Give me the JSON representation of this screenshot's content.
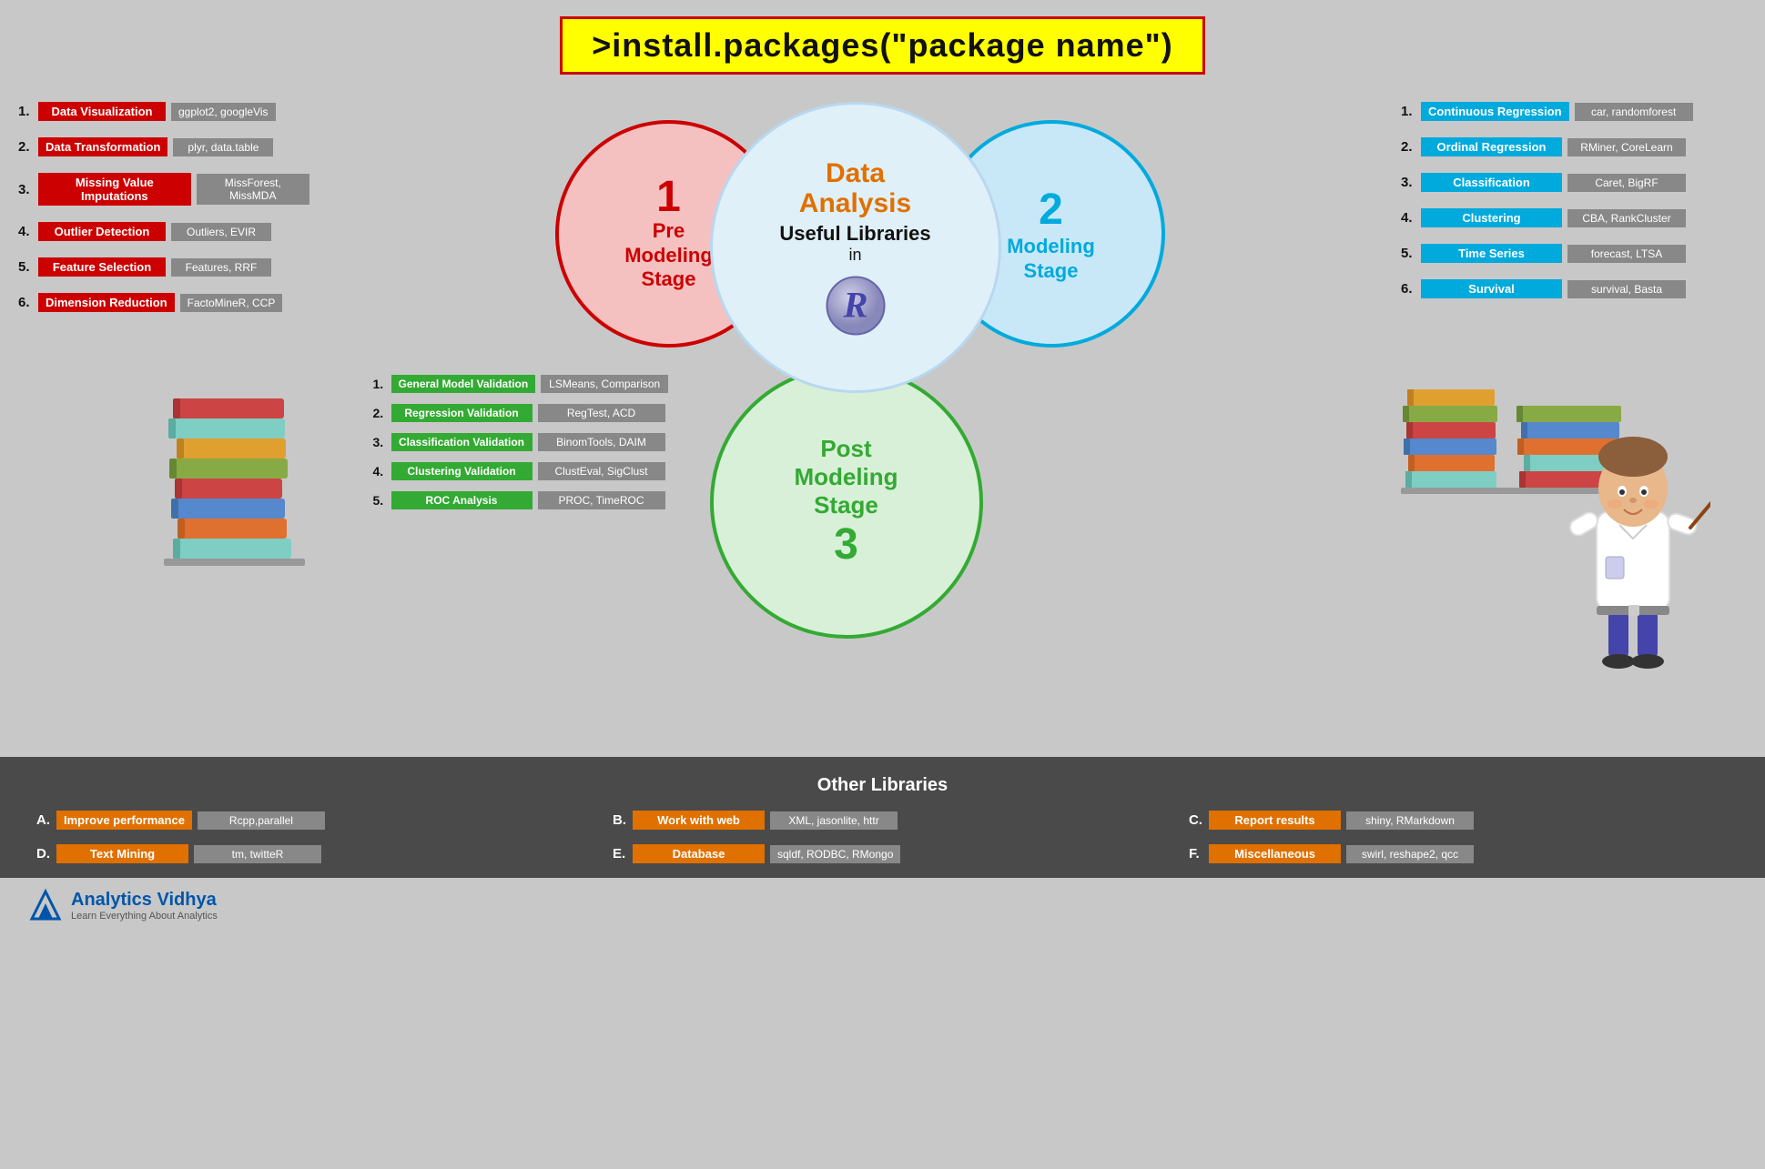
{
  "header": {
    "install_command": ">install.packages(\"package name\")"
  },
  "main_title": {
    "line1": "Data",
    "line2": "Analysis",
    "line3": "Useful Libraries",
    "line4": "in"
  },
  "pre_modeling": {
    "number": "1",
    "title": "Pre\nModeling\nStage",
    "items": [
      {
        "num": "1.",
        "label": "Data Visualization",
        "value": "ggplot2, googleVis"
      },
      {
        "num": "2.",
        "label": "Data Transformation",
        "value": "plyr, data.table"
      },
      {
        "num": "3.",
        "label": "Missing Value Imputations",
        "value": "MissForest, MissMDA"
      },
      {
        "num": "4.",
        "label": "Outlier Detection",
        "value": "Outliers, EVIR"
      },
      {
        "num": "5.",
        "label": "Feature Selection",
        "value": "Features, RRF"
      },
      {
        "num": "6.",
        "label": "Dimension Reduction",
        "value": "FactoMineR, CCP"
      }
    ]
  },
  "modeling": {
    "number": "2",
    "title": "Modeling\nStage",
    "items": [
      {
        "num": "1.",
        "label": "Continuous Regression",
        "value": "car, randomforest"
      },
      {
        "num": "2.",
        "label": "Ordinal Regression",
        "value": "RMiner, CoreLearn"
      },
      {
        "num": "3.",
        "label": "Classification",
        "value": "Caret, BigRF"
      },
      {
        "num": "4.",
        "label": "Clustering",
        "value": "CBA, RankCluster"
      },
      {
        "num": "5.",
        "label": "Time Series",
        "value": "forecast, LTSA"
      },
      {
        "num": "6.",
        "label": "Survival",
        "value": "survival, Basta"
      }
    ]
  },
  "post_modeling": {
    "number": "3",
    "title": "Post\nModeling\nStage",
    "items": [
      {
        "num": "1.",
        "label": "General Model Validation",
        "value": "LSMeans, Comparison"
      },
      {
        "num": "2.",
        "label": "Regression Validation",
        "value": "RegTest, ACD"
      },
      {
        "num": "3.",
        "label": "Classification Validation",
        "value": "BinomTools, DAIM"
      },
      {
        "num": "4.",
        "label": "Clustering Validation",
        "value": "ClustEval, SigClust"
      },
      {
        "num": "5.",
        "label": "ROC Analysis",
        "value": "PROC, TimeROC"
      }
    ]
  },
  "other_libraries": {
    "title": "Other Libraries",
    "items": [
      {
        "letter": "A.",
        "label": "Improve performance",
        "value": "Rcpp,parallel"
      },
      {
        "letter": "B.",
        "label": "Work with web",
        "value": "XML, jasonlite, httr"
      },
      {
        "letter": "C.",
        "label": "Report results",
        "value": "shiny, RMarkdown"
      },
      {
        "letter": "D.",
        "label": "Text Mining",
        "value": "tm, twitteR"
      },
      {
        "letter": "E.",
        "label": "Database",
        "value": "sqldf, RODBC, RMongo"
      },
      {
        "letter": "F.",
        "label": "Miscellaneous",
        "value": "swirl, reshape2, qcc"
      }
    ]
  },
  "footer": {
    "brand": "Analytics Vidhya",
    "tagline": "Learn Everything About Analytics"
  }
}
